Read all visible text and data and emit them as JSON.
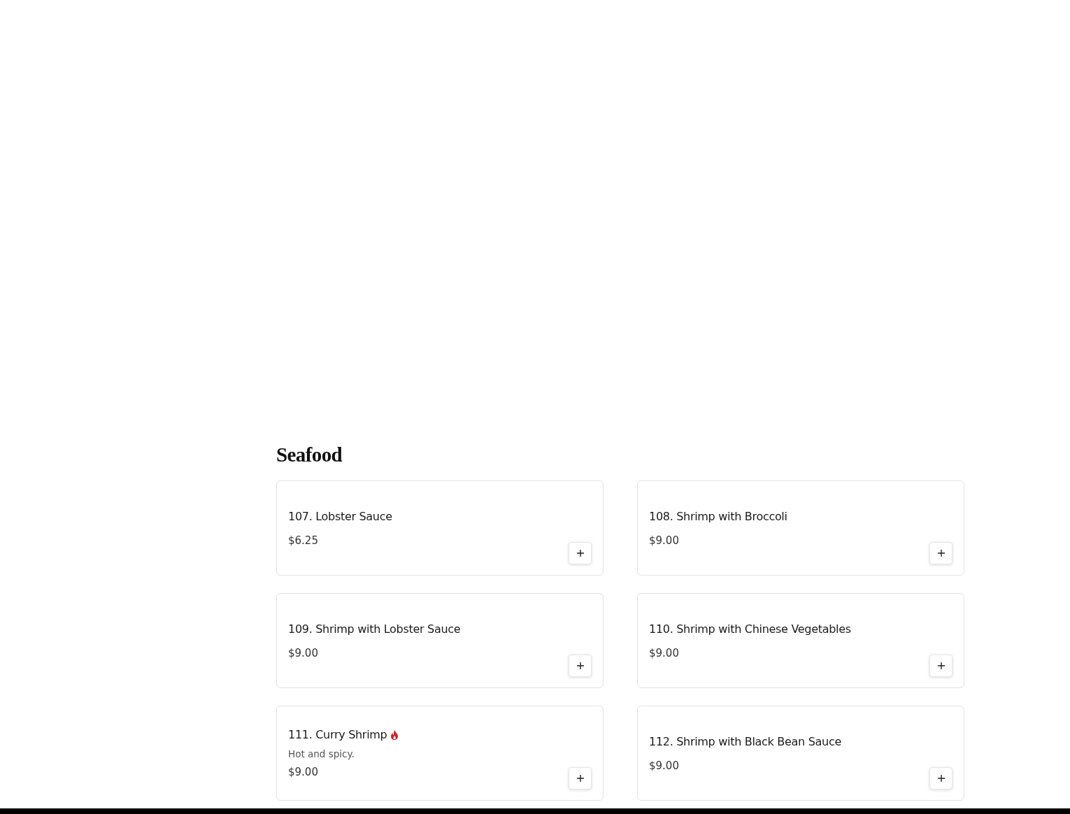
{
  "section": {
    "title": "Seafood",
    "items": [
      {
        "name": "107. Lobster Sauce",
        "price": "$6.25",
        "spicy": false
      },
      {
        "name": "108. Shrimp with Broccoli",
        "price": "$9.00",
        "spicy": false
      },
      {
        "name": "109. Shrimp with Lobster Sauce",
        "price": "$9.00",
        "spicy": false
      },
      {
        "name": "110. Shrimp with Chinese Vegetables",
        "price": "$9.00",
        "spicy": false
      },
      {
        "name": "111. Curry Shrimp",
        "description": "Hot and spicy.",
        "price": "$9.00",
        "spicy": true
      },
      {
        "name": "112. Shrimp with Black Bean Sauce",
        "price": "$9.00",
        "spicy": false
      }
    ]
  }
}
